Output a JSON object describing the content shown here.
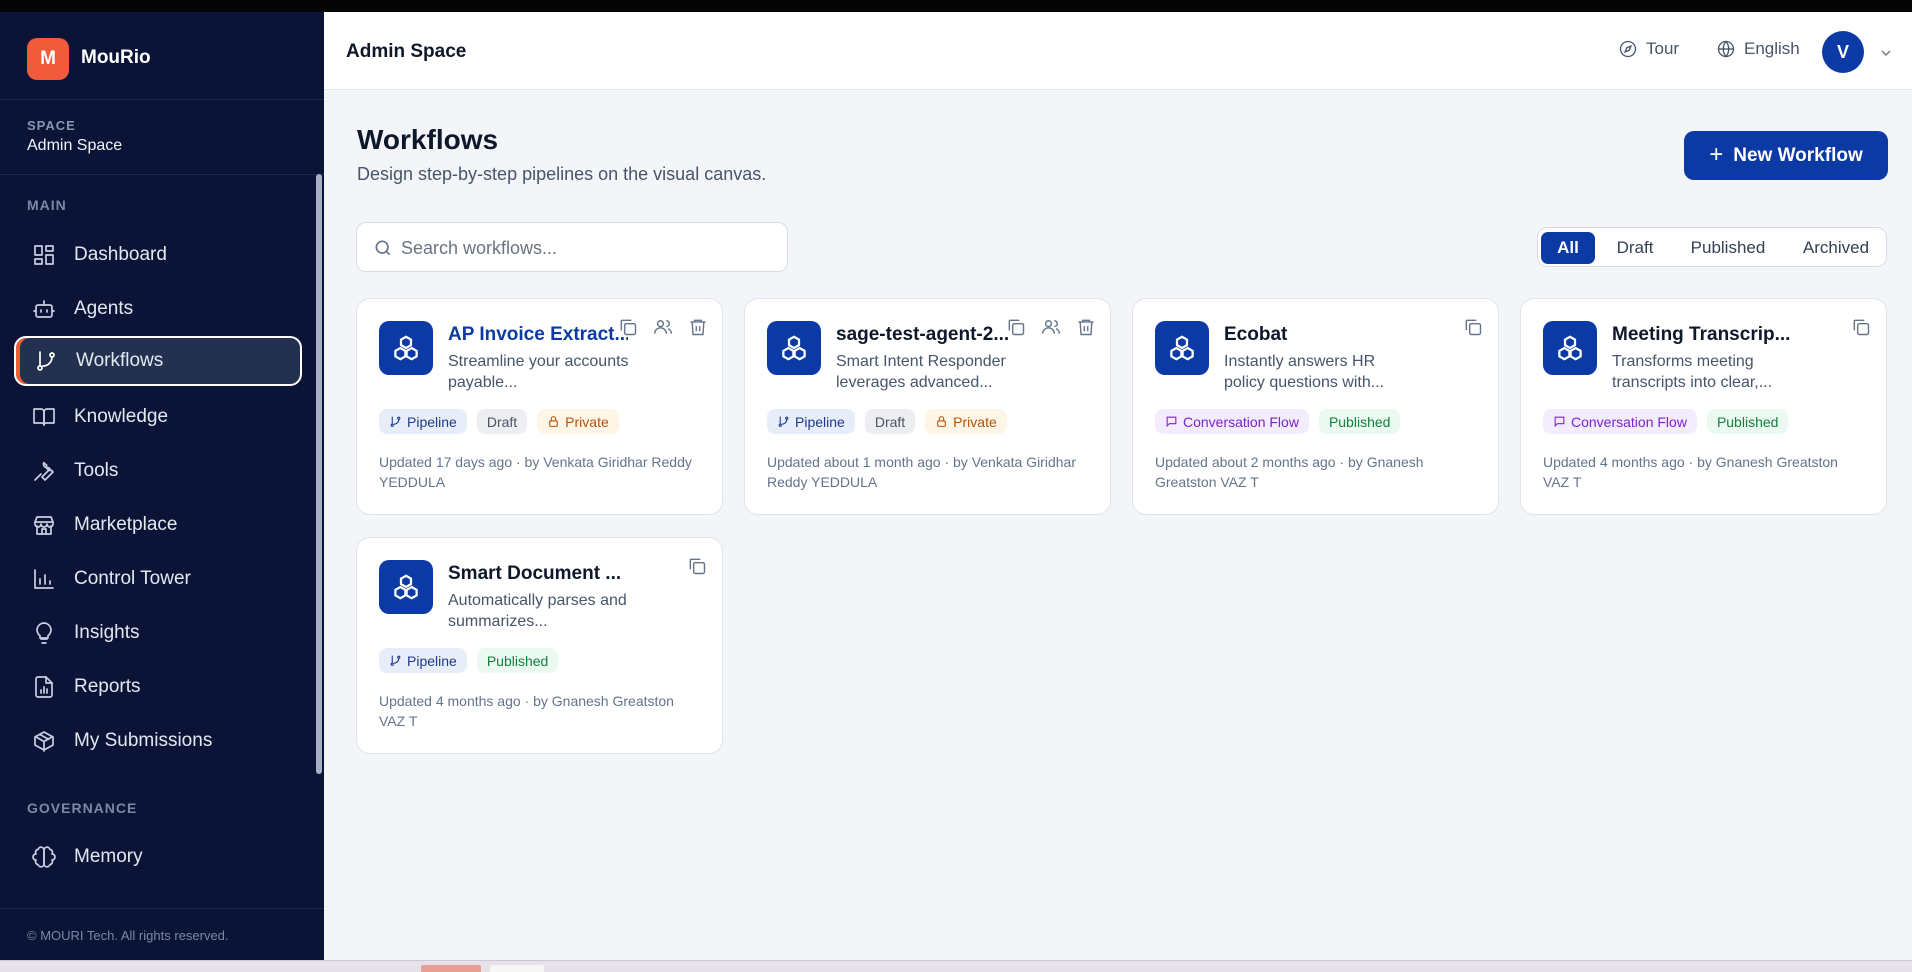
{
  "app": {
    "brand_initial": "M",
    "brand_name": "MouRio",
    "accent_color": "#0b3aa5",
    "brand_color": "#f25a3c"
  },
  "sidebar": {
    "space_label": "SPACE",
    "space_value": "Admin Space",
    "main_label": "MAIN",
    "items": [
      {
        "label": "Dashboard",
        "icon": "dashboard-icon"
      },
      {
        "label": "Agents",
        "icon": "bot-icon"
      },
      {
        "label": "Workflows",
        "icon": "git-branch-icon",
        "active": true
      },
      {
        "label": "Knowledge",
        "icon": "book-icon"
      },
      {
        "label": "Tools",
        "icon": "wrench-icon"
      },
      {
        "label": "Marketplace",
        "icon": "store-icon"
      },
      {
        "label": "Control Tower",
        "icon": "bar-chart-icon"
      },
      {
        "label": "Insights",
        "icon": "lightbulb-icon"
      },
      {
        "label": "Reports",
        "icon": "report-icon"
      },
      {
        "label": "My Submissions",
        "icon": "package-icon"
      }
    ],
    "governance_label": "GOVERNANCE",
    "governance_items": [
      {
        "label": "Memory",
        "icon": "brain-icon"
      }
    ],
    "footer": "© MOURI Tech. All rights reserved."
  },
  "header": {
    "title": "Admin Space",
    "tour_label": "Tour",
    "language_label": "English",
    "avatar_initial": "V"
  },
  "main": {
    "title": "Workflows",
    "subtitle": "Design step-by-step pipelines on the visual canvas.",
    "new_button": "New Workflow",
    "search_placeholder": "Search workflows...",
    "filters": [
      "All",
      "Draft",
      "Published",
      "Archived"
    ],
    "active_filter": "All"
  },
  "cards": [
    {
      "title": "AP Invoice Extract...",
      "description": "Streamline your accounts payable...",
      "badges": [
        "Pipeline",
        "Draft",
        "Private"
      ],
      "meta": "Updated 17 days ago · by Venkata Giridhar Reddy YEDDULA",
      "actions": [
        "copy",
        "share",
        "delete"
      ]
    },
    {
      "title": "sage-test-agent-2...",
      "description": "Smart Intent Responder leverages advanced...",
      "badges": [
        "Pipeline",
        "Draft",
        "Private"
      ],
      "meta": "Updated about 1 month ago · by Venkata Giridhar Reddy YEDDULA",
      "actions": [
        "copy",
        "share",
        "delete"
      ]
    },
    {
      "title": "Ecobat",
      "description": "Instantly answers HR policy questions with...",
      "badges": [
        "Conversation Flow",
        "Published"
      ],
      "meta": "Updated about 2 months ago · by Gnanesh Greatston VAZ T",
      "actions": [
        "copy"
      ]
    },
    {
      "title": "Meeting Transcrip...",
      "description": "Transforms meeting transcripts into clear,...",
      "badges": [
        "Conversation Flow",
        "Published"
      ],
      "meta": "Updated 4 months ago · by Gnanesh Greatston VAZ T",
      "actions": [
        "copy"
      ]
    },
    {
      "title": "Smart Document ...",
      "description": "Automatically parses and summarizes...",
      "badges": [
        "Pipeline",
        "Published"
      ],
      "meta": "Updated 4 months ago · by Gnanesh Greatston VAZ T",
      "actions": [
        "copy"
      ]
    }
  ]
}
